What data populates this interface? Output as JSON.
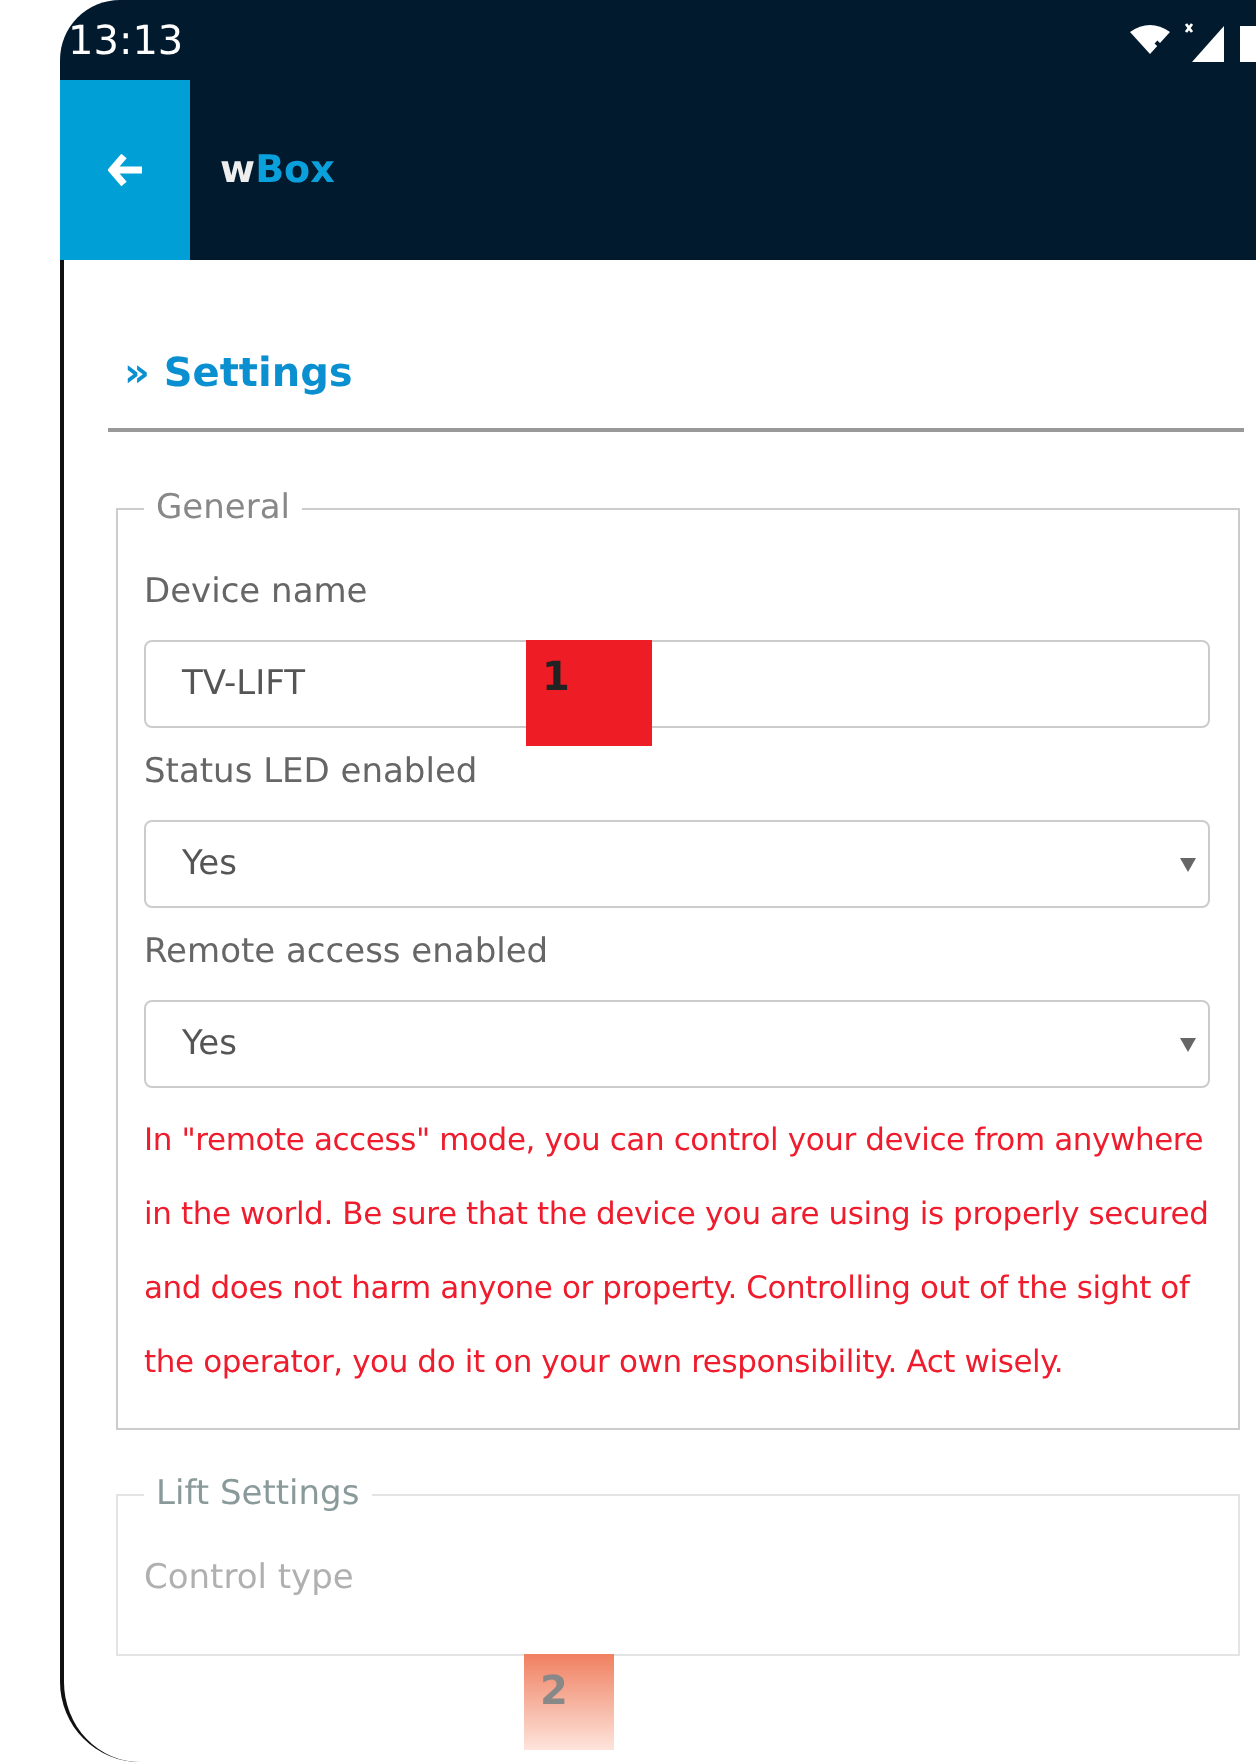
{
  "status_bar": {
    "time": "13:13"
  },
  "app_bar": {
    "title_prefix": "w",
    "title_main": "Box"
  },
  "page_heading": "» Settings",
  "sections": [
    {
      "legend": "General",
      "fields": [
        {
          "kind": "text",
          "label": "Device name",
          "value": "TV-LIFT"
        },
        {
          "kind": "select",
          "label": "Status LED enabled",
          "value": "Yes"
        },
        {
          "kind": "select",
          "label": "Remote access enabled",
          "value": "Yes"
        }
      ],
      "warning": "In \"remote access\" mode, you can control your device from anywhere in the world. Be sure that the device you are using is properly secured and does not harm anyone or property. Controlling out of the sight of the operator, you do it on your own responsibility. Act wisely."
    },
    {
      "legend": "Lift Settings",
      "fields": [
        {
          "kind": "label",
          "label": "Control type"
        }
      ]
    }
  ],
  "markers": [
    {
      "label": "1",
      "color": "#ee1c25"
    },
    {
      "label": "2",
      "color": "#f08060"
    }
  ]
}
